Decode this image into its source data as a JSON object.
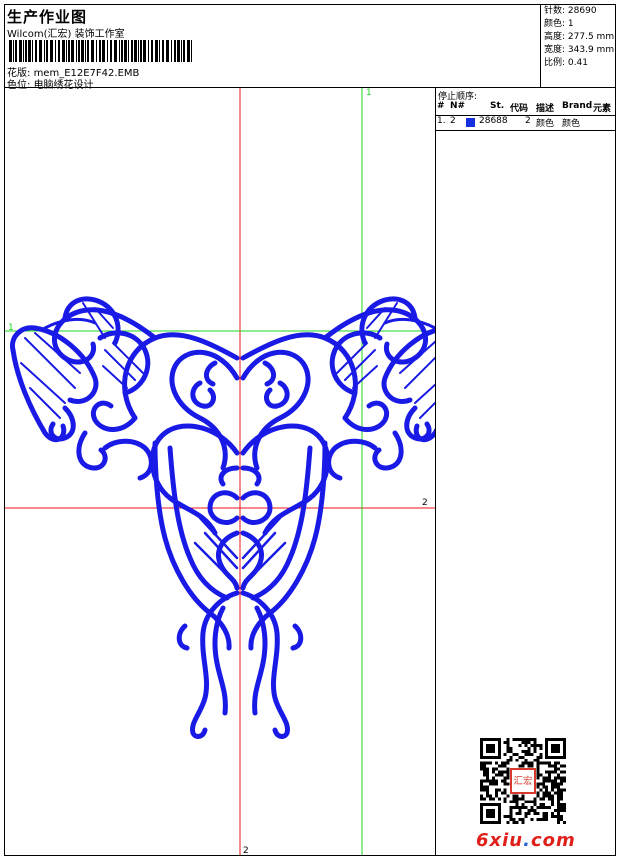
{
  "header": {
    "title": "生产作业图",
    "studio": "Wilcom(汇宏) 装饰工作室",
    "pattern_label": "花版:",
    "pattern_value": "mem_E12E7F42.EMB",
    "color_label": "色位:",
    "color_value": "电脑绣花设计"
  },
  "stats": {
    "stitches_label": "针数:",
    "stitches_value": "28690",
    "colors_label": "颜色:",
    "colors_value": "1",
    "height_label": "高度:",
    "height_value": "277.5 mm",
    "width_label": "宽度:",
    "width_value": "343.9 mm",
    "scale_label": "比例:",
    "scale_value": "0.41"
  },
  "stop_sequence": {
    "title": "停止顺序:",
    "columns": [
      "#",
      "N#",
      "St.",
      "代码",
      "描述",
      "Brand",
      "元素"
    ],
    "rows": [
      {
        "index": "1.",
        "n": "2",
        "stitches": "28688",
        "code": "2",
        "desc": "颜色",
        "brand": "颜色",
        "swatch": "#1530e0"
      }
    ]
  },
  "canvas": {
    "v_red_label": "2",
    "h_red_label": "2",
    "v_green_label": "1",
    "h_green_label": "1",
    "embroidery_color": "#1a1ae6",
    "red_guide_color": "#e8141c",
    "green_guide_color": "#1ed61e"
  },
  "watermark": {
    "logo_main": "6xiu",
    "logo_dot": ".",
    "logo_tld": "com",
    "seal_text": "汇宏"
  }
}
